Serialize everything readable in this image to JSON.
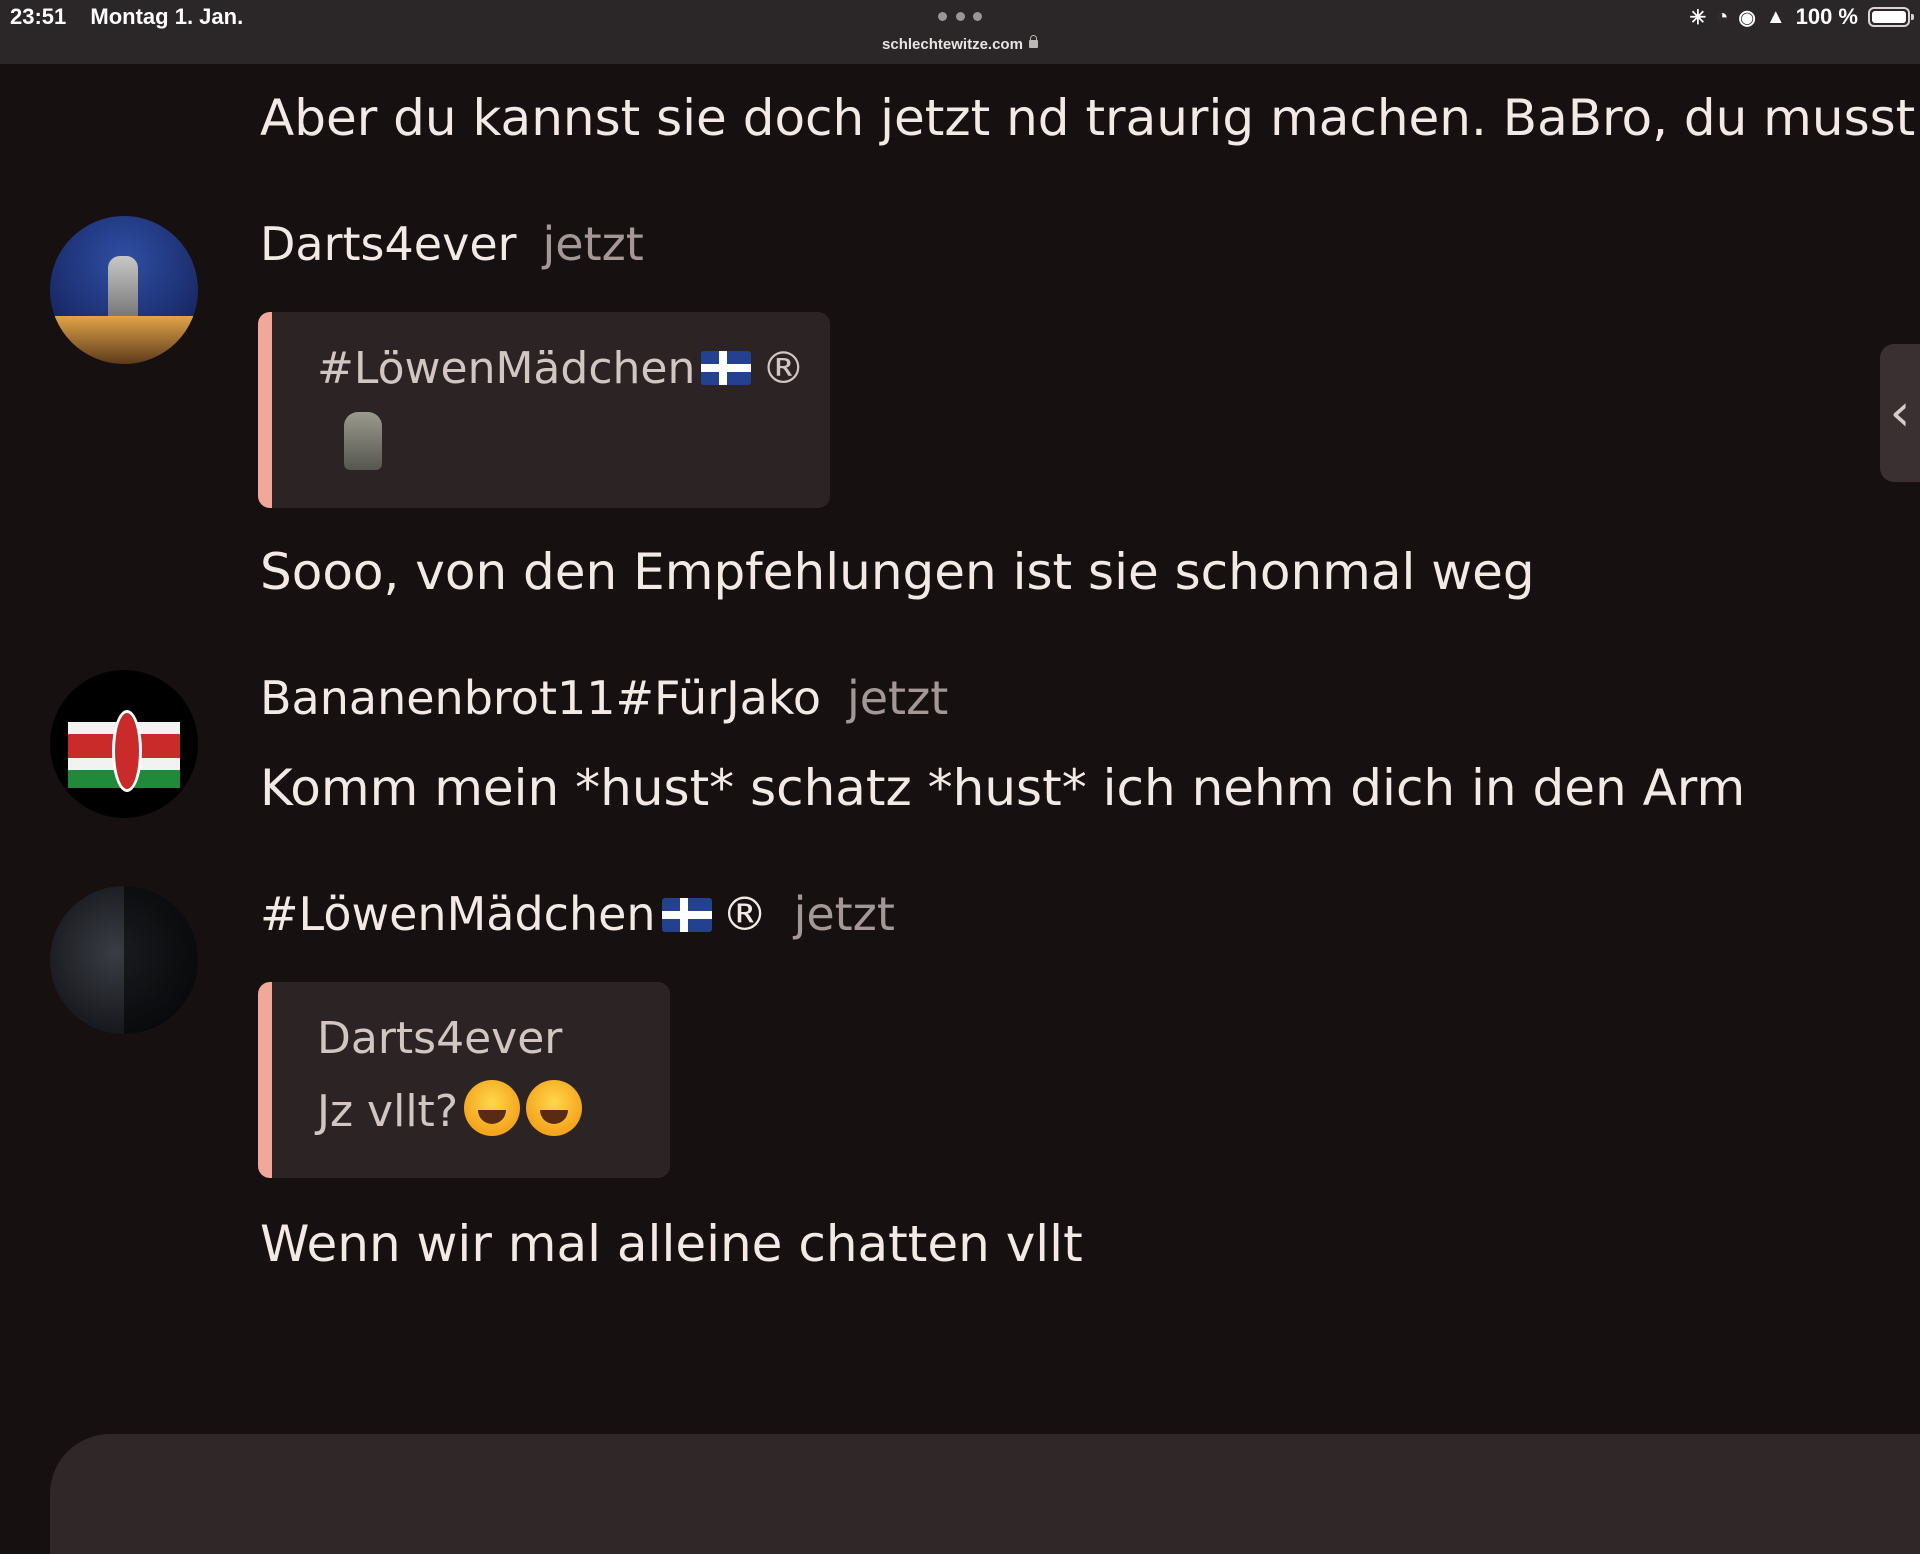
{
  "status_bar": {
    "time": "23:51",
    "date": "Montag 1. Jan.",
    "url": "schlechtewitze.com",
    "battery": "100 %"
  },
  "messages": {
    "m0_text": "Aber du kannst sie doch jetzt nd traurig machen. BaBro, du musst",
    "m1_author": "Darts4ever",
    "m1_time": "jetzt",
    "m1_quote_author": "#LöwenMädchen",
    "m1_quote_suffix": "®",
    "m1_text": "Sooo, von den Empfehlungen ist sie schonmal weg",
    "m2_author": "Bananenbrot11#FürJako",
    "m2_time": "jetzt",
    "m2_text": "Komm mein *hust* schatz *hust* ich nehm dich in den Arm",
    "m3_author": "#LöwenMädchen",
    "m3_author_suffix": "®",
    "m3_time": "jetzt",
    "m3_quote_author": "Darts4ever",
    "m3_quote_text": "Jz vllt?",
    "m3_text": "Wenn wir mal alleine chatten vllt"
  },
  "icons": {
    "side_panel": "chevron-left-icon"
  }
}
